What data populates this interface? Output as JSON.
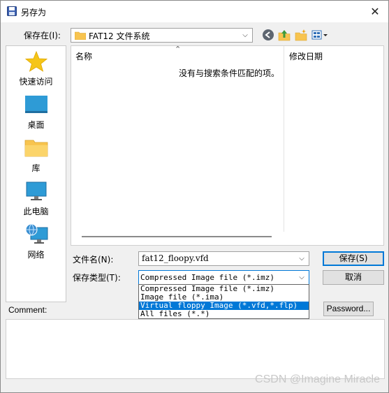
{
  "window": {
    "title": "另存为"
  },
  "savein": {
    "label": "保存在(I):",
    "value": "FAT12 文件系统"
  },
  "toolbar": {
    "back_icon": "back-arrow-icon",
    "up_icon": "folder-up-icon",
    "new_folder_icon": "new-folder-icon",
    "view_icon": "view-menu-icon"
  },
  "places": [
    {
      "label": "快速访问",
      "icon": "star-icon"
    },
    {
      "label": "桌面",
      "icon": "desktop-icon"
    },
    {
      "label": "库",
      "icon": "library-folder-icon"
    },
    {
      "label": "此电脑",
      "icon": "computer-icon"
    },
    {
      "label": "网络",
      "icon": "network-icon"
    }
  ],
  "filelist": {
    "col_name": "名称",
    "col_modified": "修改日期",
    "empty_message": "没有与搜索条件匹配的项。"
  },
  "filename": {
    "label": "文件名(N):",
    "value": "fat12_floopy.vfd"
  },
  "filetype": {
    "label": "保存类型(T):",
    "value": "Compressed Image file (*.imz)",
    "options": [
      "Compressed Image file (*.imz)",
      "Image file (*.ima)",
      "Virtual floppy Image (*.vfd,*.flp)",
      "All files (*.*)"
    ],
    "highlighted_index": 2
  },
  "buttons": {
    "save": "保存(S)",
    "cancel": "取消",
    "password": "Password..."
  },
  "comment": {
    "label": "Comment:"
  },
  "watermark": "CSDN @Imagine Miracle",
  "colors": {
    "accent": "#0078d7",
    "star": "#f5c518",
    "folder": "#f8c44f",
    "desktop": "#2e9bd6"
  }
}
